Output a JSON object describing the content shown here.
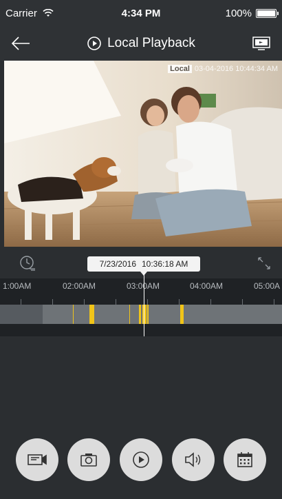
{
  "status_bar": {
    "carrier": "Carrier",
    "time": "4:34 PM",
    "battery": "100%"
  },
  "nav": {
    "title": "Local Playback"
  },
  "video": {
    "osd_tag": "Local",
    "osd_timestamp": "03-04-2016  10:44:34 AM"
  },
  "timeline": {
    "bubble_date": "7/23/2016",
    "bubble_time": "10:36:18 AM",
    "hour_labels": [
      "1:00AM",
      "02:00AM",
      "03:00AM",
      "04:00AM",
      "05:00A"
    ]
  },
  "colors": {
    "background": "#2b2e31",
    "recording": "#f0c419",
    "button": "#dcdcdc"
  },
  "controls": {
    "icons": [
      "record-video-icon",
      "snapshot-icon",
      "play-icon",
      "volume-icon",
      "calendar-icon"
    ]
  }
}
